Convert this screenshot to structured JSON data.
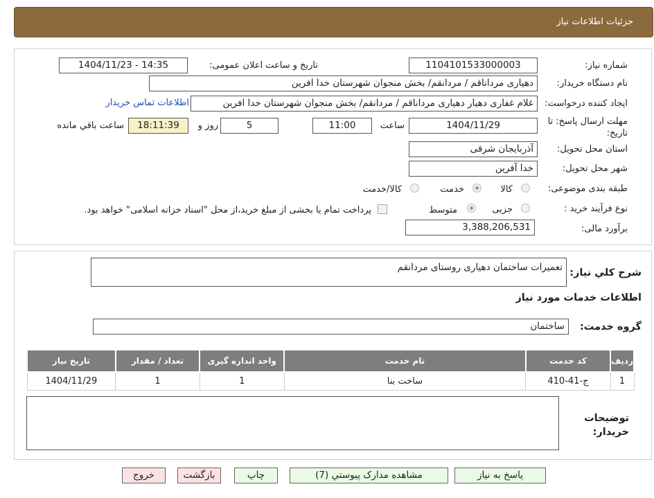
{
  "header": {
    "title": "جزئیات اطلاعات نیاز"
  },
  "form": {
    "need_number_label": "شماره نیاز:",
    "need_number": "1104101533000003",
    "announce_label": "تاریخ و ساعت اعلان عمومی:",
    "announce_value": "1404/11/23 - 14:35",
    "buyer_org_label": "نام دستگاه خریدار:",
    "buyer_org": "دهیاری مرداناقم / مردانقم/ بخش منجوان شهرستان خدا افرین",
    "requester_label": "ایجاد کننده درخواست:",
    "requester": "غلام غفاری دهیار دهیاری مرداناقم / مردانقم/ بخش منجوان شهرستان خدا افرین",
    "contact_link": "اطلاعات تماس خریدار",
    "deadline_label": "مهلت ارسال پاسخ: تا تاریخ:",
    "deadline_date": "1404/11/29",
    "time_label": "ساعت",
    "deadline_time": "11:00",
    "days_value": "5",
    "days_label": "روز و",
    "remaining_time": "18:11:39",
    "remaining_label": "ساعت باقي مانده",
    "province_label": "استان محل تحویل:",
    "province": "آذربایجان شرقی",
    "city_label": "شهر محل تحویل:",
    "city": "خدا آفرین",
    "category_label": "طبقه بندی موضوعی:",
    "category_options": [
      "کالا",
      "خدمت",
      "کالا/خدمت"
    ],
    "process_label": "نوع فرآیند خرید :",
    "process_options": [
      "جزیی",
      "متوسط"
    ],
    "process_note": "پرداخت تمام یا بخشی از مبلغ خرید،از محل \"اسناد خزانه اسلامی\" خواهد بود.",
    "budget_label": "برآورد مالی:",
    "budget": "3,388,206,531"
  },
  "description": {
    "label": "شرح کلي نياز:",
    "value": "تعمیرات ساختمان دهیاری روستای مردانقم"
  },
  "services": {
    "section_title": "اطلاعات خدمات مورد نیاز",
    "group_label": "گروه خدمت:",
    "group_value": "ساختمان",
    "columns": [
      "ردیف",
      "کد خدمت",
      "نام خدمت",
      "واحد اندازه گیری",
      "تعداد / مقدار",
      "تاریخ نیاز"
    ],
    "rows": [
      [
        "1",
        "ج-41-410",
        "ساخت بنا",
        "1",
        "1",
        "1404/11/29"
      ]
    ]
  },
  "notes": {
    "label": "توضیحات خریدار:",
    "value": ""
  },
  "buttons": {
    "reply": "پاسخ به نیاز",
    "attachments": "مشاهده مدارک پیوستي (7)",
    "print": "چاپ",
    "back": "بازگشت",
    "exit": "خروج"
  }
}
